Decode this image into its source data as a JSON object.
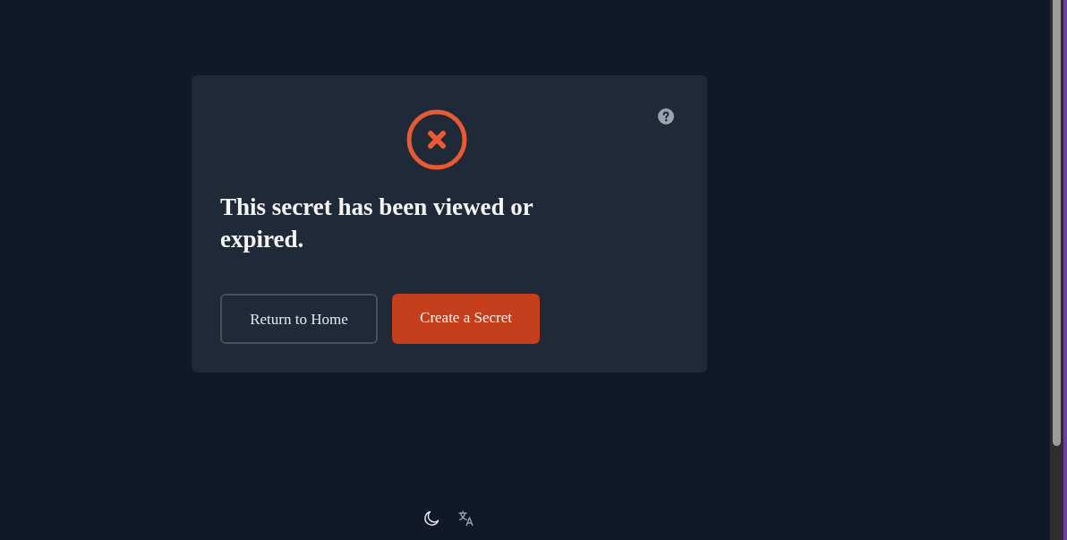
{
  "message": {
    "title": "This secret has been viewed or expired."
  },
  "buttons": [
    {
      "label": "Return to Home",
      "kind": "outline"
    },
    {
      "label": "Create a Secret",
      "kind": "primary"
    }
  ]
}
